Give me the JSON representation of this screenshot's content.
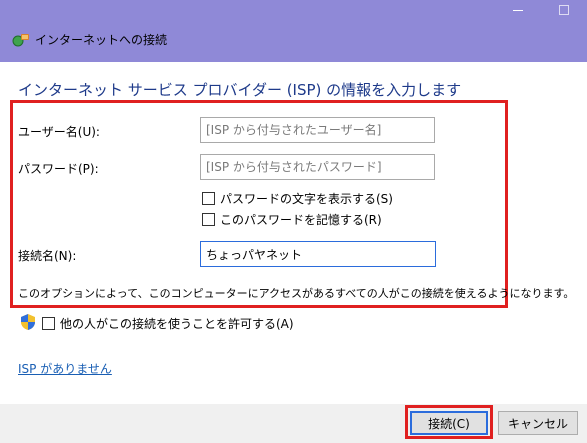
{
  "window": {
    "title": "インターネットへの接続"
  },
  "heading": "インターネット サービス プロバイダー (ISP) の情報を入力します",
  "form": {
    "username_label": "ユーザー名(U):",
    "username_placeholder": "[ISP から付与されたユーザー名]",
    "password_label": "パスワード(P):",
    "password_placeholder": "[ISP から付与されたパスワード]",
    "show_password_label": "パスワードの文字を表示する(S)",
    "remember_password_label": "このパスワードを記憶する(R)",
    "connection_name_label": "接続名(N):",
    "connection_name_value": "ちょっパヤネット",
    "note": "このオプションによって、このコンピューターにアクセスがあるすべての人がこの接続を使えるようになります。"
  },
  "allow_others_label": "他の人がこの接続を使うことを許可する(A)",
  "no_isp_link": "ISP がありません",
  "buttons": {
    "connect": "接続(C)",
    "cancel": "キャンセル"
  },
  "colors": {
    "titlebar": "#8f89d7",
    "heading": "#1e3a8a",
    "highlight": "#e02020",
    "link": "#1a5fb4"
  },
  "icons": [
    "network-globe-icon",
    "uac-shield-icon",
    "minimize-icon",
    "maximize-icon"
  ]
}
